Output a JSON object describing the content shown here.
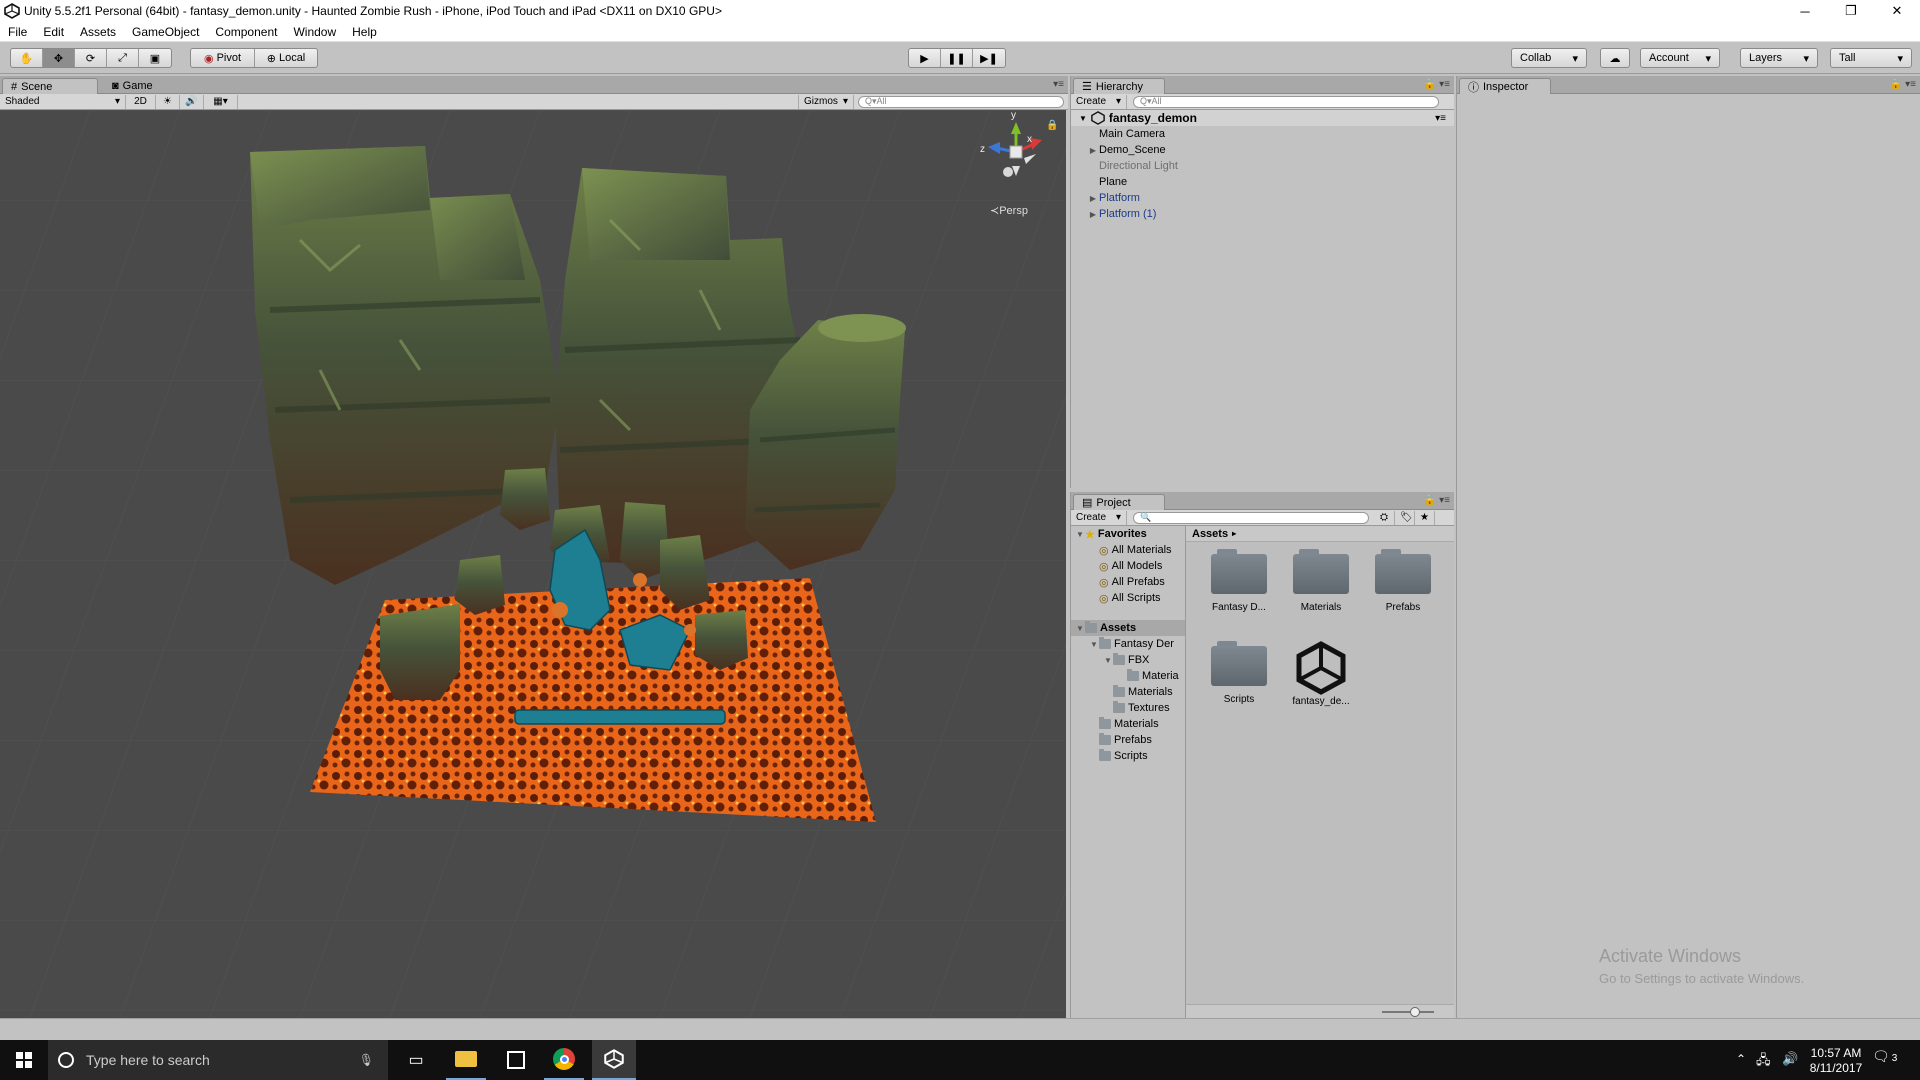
{
  "window": {
    "title": "Unity 5.5.2f1 Personal (64bit) - fantasy_demon.unity - Haunted Zombie Rush - iPhone, iPod Touch and iPad <DX11 on DX10 GPU>",
    "min_label": "─",
    "max_label": "❐",
    "close_label": "✕"
  },
  "menu": [
    "File",
    "Edit",
    "Assets",
    "GameObject",
    "Component",
    "Window",
    "Help"
  ],
  "toolbar": {
    "pivot": "Pivot",
    "local": "Local",
    "play": "▶",
    "pause": "❚❚",
    "step": "▶❚",
    "collab": "Collab",
    "account": "Account",
    "layers": "Layers",
    "layout": "Tall"
  },
  "scene": {
    "tab_scene": "Scene",
    "tab_game": "Game",
    "shading": "Shaded",
    "mode_2d": "2D",
    "gizmos": "Gizmos",
    "search_placeholder": "Q▾All",
    "persp": "Persp",
    "axis_y": "y",
    "axis_z": "z",
    "axis_x": "x"
  },
  "hierarchy": {
    "tab": "Hierarchy",
    "create": "Create",
    "search_placeholder": "Q▾All",
    "root": "fantasy_demon",
    "items": [
      {
        "label": "Main Camera",
        "style": "normal",
        "expandable": false
      },
      {
        "label": "Demo_Scene",
        "style": "normal",
        "expandable": true
      },
      {
        "label": "Directional Light",
        "style": "gray",
        "expandable": false
      },
      {
        "label": "Plane",
        "style": "normal",
        "expandable": false
      },
      {
        "label": "Platform",
        "style": "blue",
        "expandable": true
      },
      {
        "label": "Platform (1)",
        "style": "blue",
        "expandable": true
      }
    ]
  },
  "inspector": {
    "tab": "Inspector"
  },
  "project": {
    "tab": "Project",
    "create": "Create",
    "favorites": "Favorites",
    "favorite_items": [
      "All Materials",
      "All Models",
      "All Prefabs",
      "All Scripts"
    ],
    "assets_root": "Assets",
    "tree": [
      {
        "label": "Fantasy Der",
        "depth": 1,
        "expandable": true
      },
      {
        "label": "FBX",
        "depth": 2,
        "expandable": true
      },
      {
        "label": "Materia",
        "depth": 3,
        "expandable": false
      },
      {
        "label": "Materials",
        "depth": 2,
        "expandable": false
      },
      {
        "label": "Textures",
        "depth": 2,
        "expandable": false
      },
      {
        "label": "Materials",
        "depth": 1,
        "expandable": false
      },
      {
        "label": "Prefabs",
        "depth": 1,
        "expandable": false
      },
      {
        "label": "Scripts",
        "depth": 1,
        "expandable": false
      }
    ],
    "breadcrumb": "Assets",
    "assets": [
      {
        "label": "Fantasy D...",
        "kind": "folder"
      },
      {
        "label": "Materials",
        "kind": "folder"
      },
      {
        "label": "Prefabs",
        "kind": "folder"
      },
      {
        "label": "Scripts",
        "kind": "folder"
      },
      {
        "label": "fantasy_de...",
        "kind": "unity-scene"
      }
    ]
  },
  "watermark": {
    "line1": "Activate Windows",
    "line2": "Go to Settings to activate Windows."
  },
  "taskbar": {
    "search_placeholder": "Type here to search",
    "time": "10:57 AM",
    "date": "8/11/2017",
    "notification_count": "3"
  },
  "colors": {
    "unity_panel": "#c2c2c2",
    "scene_bg": "#4a4a4a",
    "lava": "#e05a10",
    "rock": "#4e5e3c",
    "taskbar": "#101010",
    "prefab_blue": "#1b3c8a"
  }
}
